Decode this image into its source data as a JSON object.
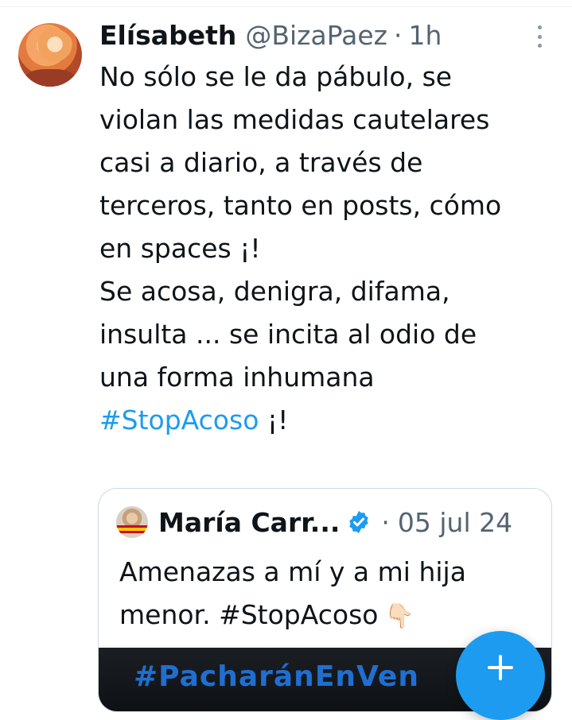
{
  "tweet": {
    "author_name": "Elísabeth",
    "handle": "@BizaPaez",
    "separator": "·",
    "time": "1h",
    "text": "No sólo se le da pábulo, se\nviolan las medidas cautelares\ncasi a diario, a través de\nterceros, tanto en posts, cómo\nen spaces ¡!\nSe acosa, denigra, difama,\ninsulta ... se incita al odio de\nuna forma inhumana\n",
    "hashtag": "#StopAcoso",
    "hashtag_suffix": " ¡!"
  },
  "quote": {
    "author_name": "María Carr...",
    "separator": "·",
    "date": "05 jul 24",
    "text": "Amenazas a mí y a mi hija menor. #StopAcoso",
    "emoji": "👇🏻",
    "media_text": "#PacharánEnVen"
  },
  "colors": {
    "accent": "#1d9bf0",
    "text_primary": "#0f1419",
    "text_secondary": "#536471",
    "border": "#cfd9de"
  },
  "icons": {
    "more": "more-vertical-icon",
    "verified": "verified-badge-icon",
    "compose": "plus-icon"
  }
}
